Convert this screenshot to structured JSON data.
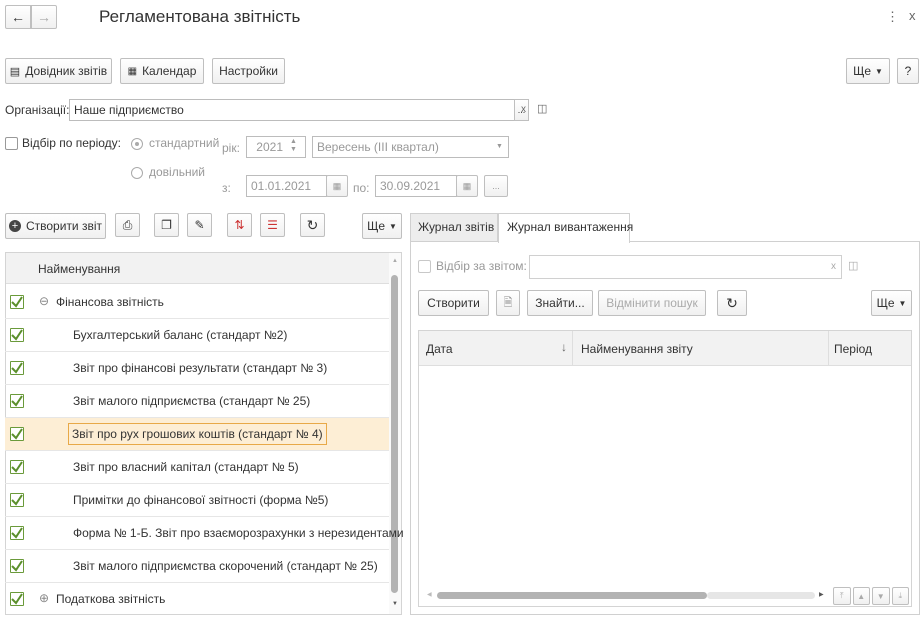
{
  "header": {
    "title": "Регламентована звітність",
    "more_icon": "⋮",
    "close_icon": "x"
  },
  "toolbar": {
    "reports_ref": "Довідник звітів",
    "calendar": "Календар",
    "settings": "Настройки",
    "more": "Ще",
    "help": "?"
  },
  "filters": {
    "org_label": "Організації:",
    "org_value": "Наше підприємство",
    "period_filter_label": "Відбір по періоду:",
    "standard_label": "стандартний",
    "custom_label": "довільний",
    "year_label": "рік:",
    "year_value": "2021",
    "period_value": "Вересень (III квартал)",
    "from_label": "з:",
    "from_value": "01.01.2021",
    "to_label": "по:",
    "to_value": "30.09.2021",
    "dots": "..."
  },
  "left": {
    "create_label": "Створити звіт",
    "more": "Ще",
    "column_header": "Найменування",
    "groups": [
      {
        "label": "Фінансова звітність",
        "toggle": "⊖"
      },
      {
        "label": "Податкова звітність",
        "toggle": "⊕"
      }
    ],
    "items": [
      "Бухгалтерський баланс (стандарт №2)",
      "Звіт про фінансові результати (стандарт № 3)",
      "Звіт малого підприємства (стандарт № 25)",
      "Звіт про рух грошових коштів (стандарт № 4)",
      "Звіт про власний капітал (стандарт № 5)",
      "Примітки до фінансової звітності (форма №5)",
      "Форма № 1-Б. Звіт про взаєморозрахунки з нерезидентами",
      "Звіт малого підприємства скорочений (стандарт № 25)"
    ],
    "selected_index": 3
  },
  "right": {
    "tabs": [
      "Журнал звітів",
      "Журнал вивантаження"
    ],
    "active_tab": 1,
    "filter_label": "Відбір за звітом:",
    "create": "Створити",
    "find": "Знайти...",
    "cancel_search": "Відмінити пошук",
    "more": "Ще",
    "columns": [
      "Дата",
      "Найменування звіту",
      "Період"
    ]
  },
  "colors": {
    "selected_row": "#fdeed5",
    "selected_border": "#e8a948",
    "check": "#5b8f2c"
  }
}
